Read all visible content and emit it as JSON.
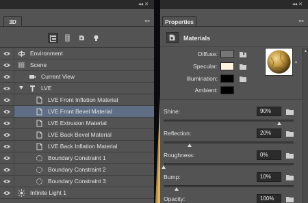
{
  "panel3d": {
    "tab_label": "3D",
    "dock_controls": "◂◂ ✕",
    "menu_glyph": "▾≡",
    "tools": [
      "scene-filter-icon",
      "mesh-filter-icon",
      "material-filter-icon",
      "light-filter-icon"
    ],
    "items": [
      {
        "label": "Environment",
        "icon": "environment-icon",
        "indent": 0
      },
      {
        "label": "Scene",
        "icon": "scene-icon",
        "indent": 0
      },
      {
        "label": "Current View",
        "icon": "camera-icon",
        "indent": 1
      },
      {
        "label": "LVE",
        "icon": "mesh-icon",
        "indent": 1,
        "expanded": true
      },
      {
        "label": "LVE Front Inflation Material",
        "icon": "material-icon",
        "indent": 2
      },
      {
        "label": "LVE Front Bevel Material",
        "icon": "material-icon",
        "indent": 2,
        "selected": true
      },
      {
        "label": "LVE Extrusion Material",
        "icon": "material-icon",
        "indent": 2
      },
      {
        "label": "LVE Back Bevel Material",
        "icon": "material-icon",
        "indent": 2
      },
      {
        "label": "LVE Back Inflation Material",
        "icon": "material-icon",
        "indent": 2
      },
      {
        "label": "Boundary Constraint 1",
        "icon": "constraint-icon",
        "indent": 2
      },
      {
        "label": "Boundary Constraint 2",
        "icon": "constraint-icon",
        "indent": 2
      },
      {
        "label": "Boundary Constraint 3",
        "icon": "constraint-icon",
        "indent": 2
      },
      {
        "label": "Infinite Light 1",
        "icon": "light-icon",
        "indent": 0
      }
    ]
  },
  "properties": {
    "tab_label": "Properties",
    "dock_controls": "◂◂ ✕",
    "menu_glyph": "▾≡",
    "section_title": "Materials",
    "colors": [
      {
        "label": "Diffuse:",
        "color": "#767676"
      },
      {
        "label": "Specular:",
        "color": "#fff4dc"
      },
      {
        "label": "Illumination:",
        "color": "#000000"
      },
      {
        "label": "Ambient:",
        "color": "#000000"
      }
    ],
    "preview_arrow": "▾",
    "sliders": [
      {
        "label": "Shine:",
        "value": "90%",
        "level": 0.9
      },
      {
        "label": "Reflection:",
        "value": "20%",
        "level": 0.2
      },
      {
        "label": "Roughness:",
        "value": "0%",
        "level": 0.0
      },
      {
        "label": "Bump:",
        "value": "10%",
        "level": 0.1
      },
      {
        "label": "Opacity:",
        "value": "100%",
        "level": 1.0
      }
    ]
  }
}
